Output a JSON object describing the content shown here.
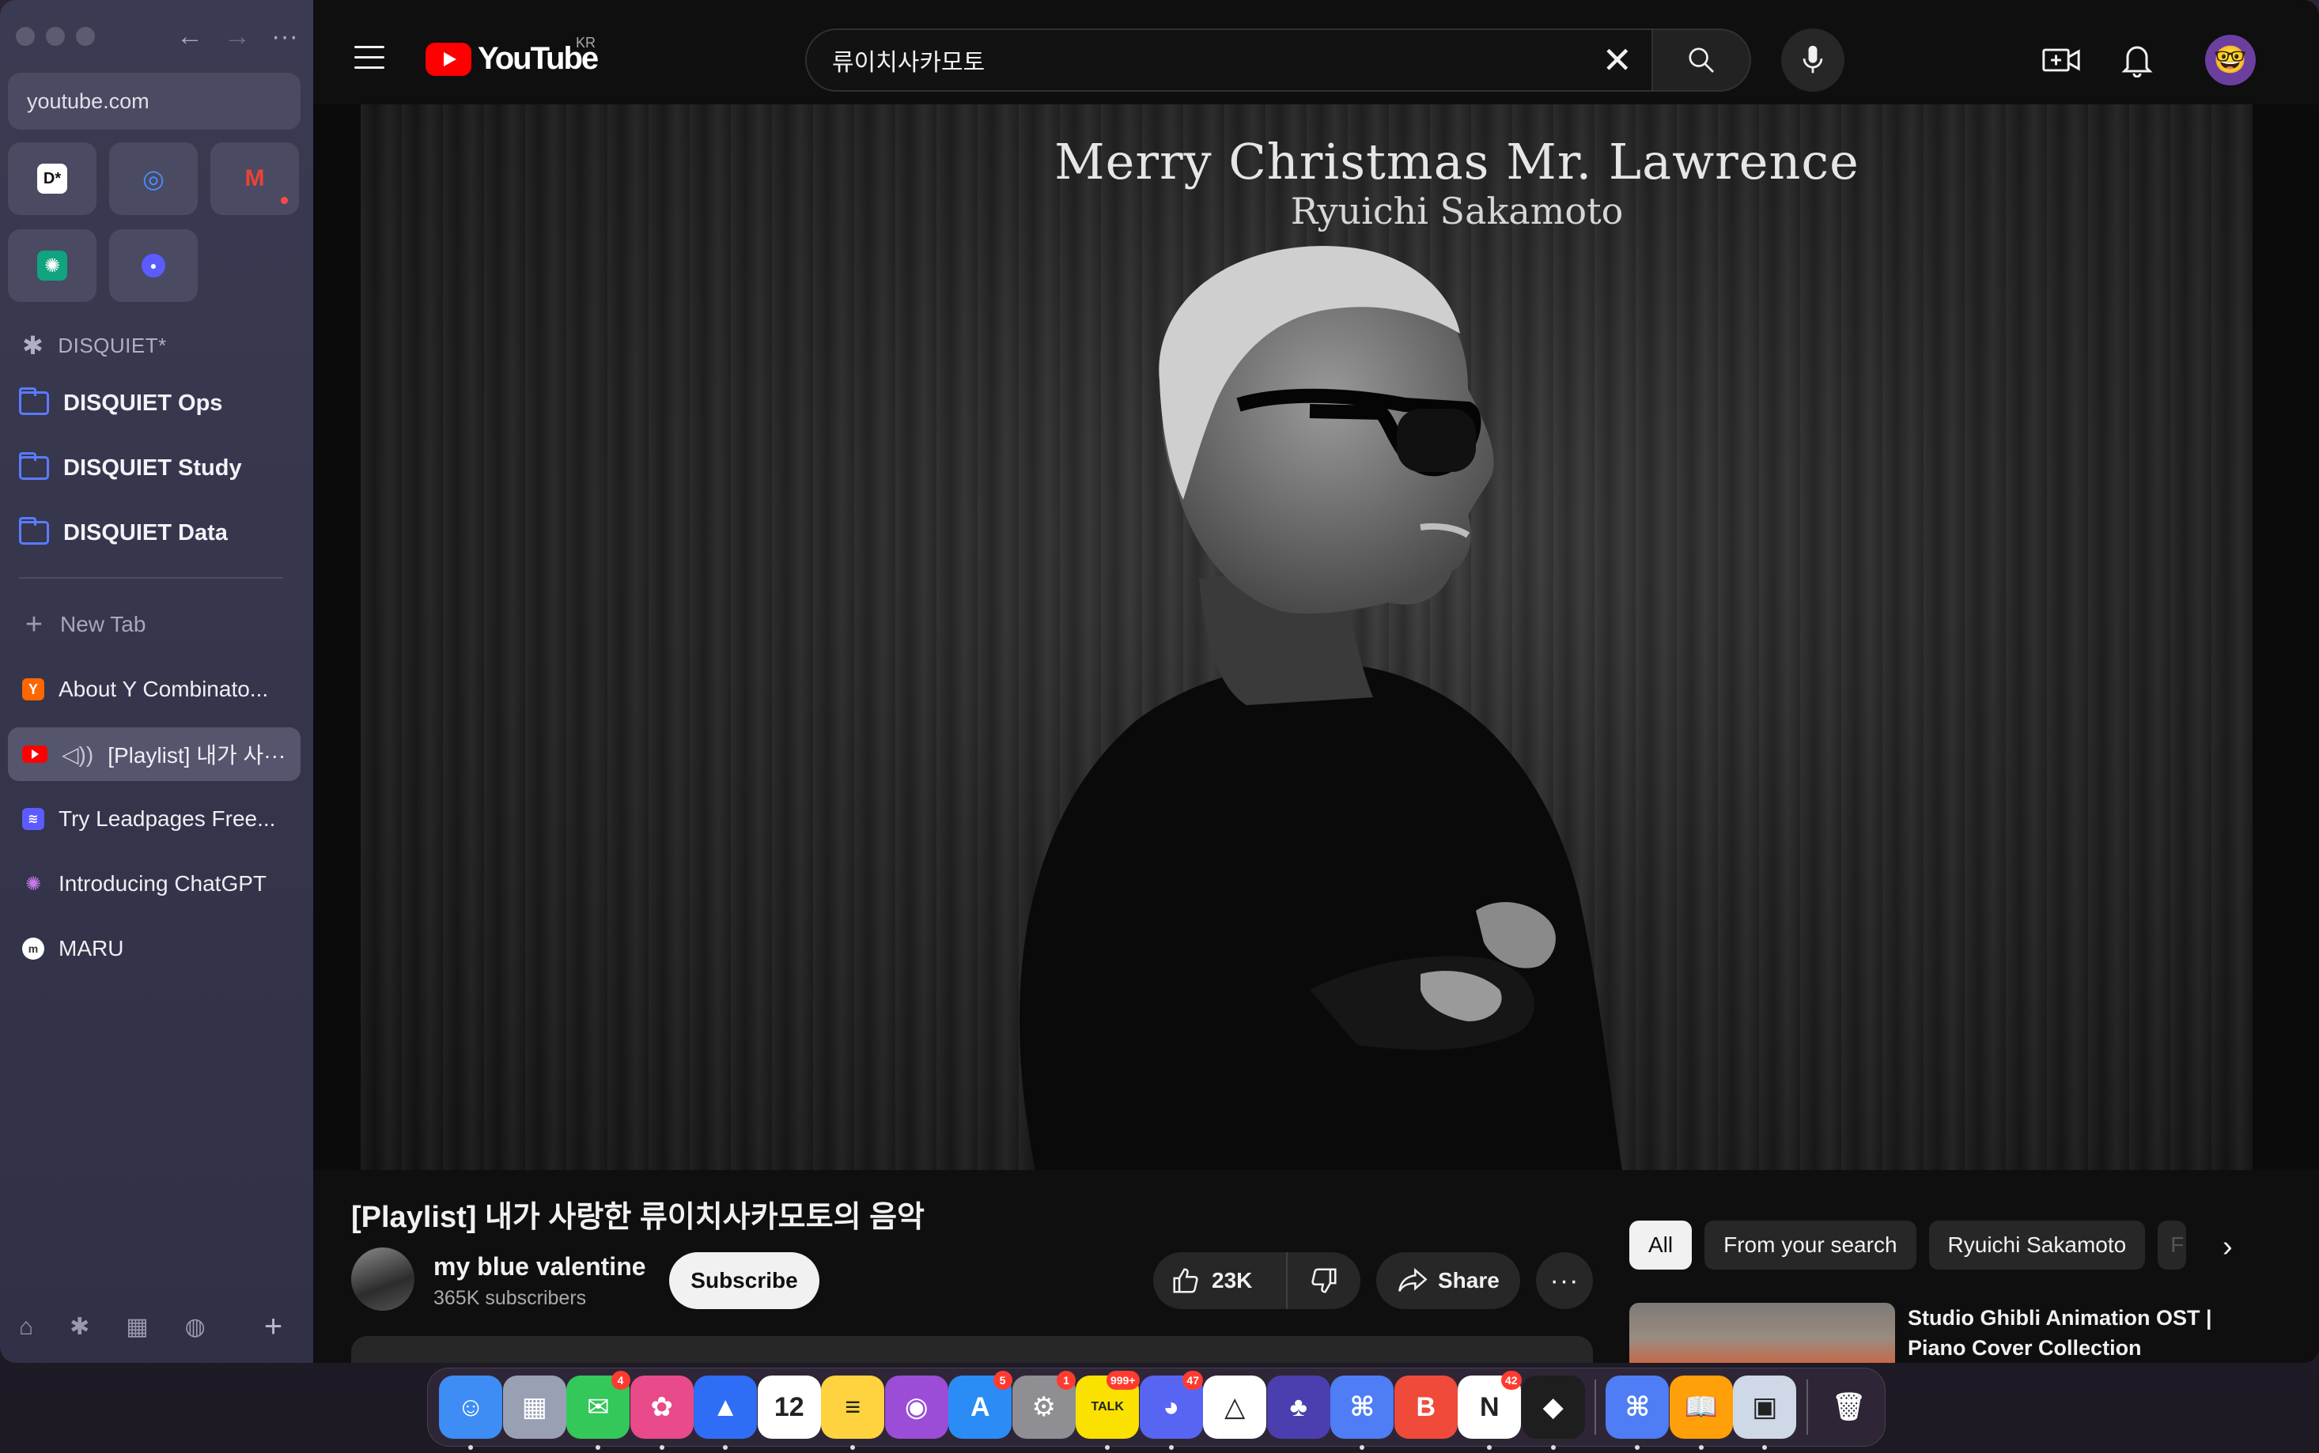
{
  "browser": {
    "url": "youtube.com",
    "space_label": "DISQUIET*",
    "folders": [
      {
        "label": "DISQUIET Ops"
      },
      {
        "label": "DISQUIET Study"
      },
      {
        "label": "DISQUIET Data"
      }
    ],
    "new_tab_label": "New Tab",
    "tabs": [
      {
        "label": "About Y Combinato...",
        "favicon": "Y",
        "color": "#ff6600"
      },
      {
        "label": "[Playlist] 내가 사···",
        "favicon": "youtube-icon",
        "color": "#ff0000",
        "active": true
      },
      {
        "label": "Try Leadpages Free...",
        "favicon": "leadpages-icon",
        "color": "#5b5bff"
      },
      {
        "label": "Introducing ChatGPT",
        "favicon": "openai-icon",
        "color": "#b06bd6"
      },
      {
        "label": "MARU",
        "favicon": "maru-icon",
        "color": "#ffffff"
      }
    ],
    "pinned": [
      {
        "name": "disquiet-app",
        "glyph": "D*"
      },
      {
        "name": "target-app",
        "glyph": "◎"
      },
      {
        "name": "gmail-app",
        "glyph": "M"
      },
      {
        "name": "chatgpt-app",
        "glyph": "✺"
      },
      {
        "name": "dot-app",
        "glyph": "●"
      }
    ]
  },
  "youtube": {
    "logo_text": "YouTube",
    "region": "KR",
    "search_query": "류이치사카모토",
    "video_overlay_title": "Merry Christmas Mr.  Lawrence",
    "video_overlay_subtitle": "Ryuichi Sakamoto",
    "video_title": "[Playlist] 내가 사랑한 류이치사카모토의 음악",
    "channel_name": "my blue valentine",
    "channel_subs": "365K subscribers",
    "subscribe_label": "Subscribe",
    "likes": "23K",
    "share_label": "Share",
    "chips": [
      "All",
      "From your search",
      "Ryuichi Sakamoto",
      "F"
    ],
    "recommended": {
      "title": "Studio Ghibli Animation OST | Piano Cover Collection"
    }
  },
  "dock": {
    "apps": [
      {
        "name": "finder",
        "glyph": "☺",
        "bg": "#3d8df5",
        "badge": "",
        "running": true
      },
      {
        "name": "launchpad",
        "glyph": "▦",
        "bg": "#9aa0b4",
        "badge": "",
        "running": false
      },
      {
        "name": "messages",
        "glyph": "✉",
        "bg": "#34c759",
        "badge": "4",
        "running": true
      },
      {
        "name": "photo-editor",
        "glyph": "✿",
        "bg": "#e84a8a",
        "badge": "",
        "running": true
      },
      {
        "name": "spark",
        "glyph": "▲",
        "bg": "#2f6df6",
        "badge": "",
        "running": true
      },
      {
        "name": "calendar",
        "glyph": "12",
        "bg": "#ffffff",
        "badge": "",
        "running": false
      },
      {
        "name": "notes",
        "glyph": "≡",
        "bg": "#ffd23f",
        "badge": "",
        "running": true
      },
      {
        "name": "podcasts",
        "glyph": "◉",
        "bg": "#9b4dd8",
        "badge": "",
        "running": false
      },
      {
        "name": "app-store",
        "glyph": "A",
        "bg": "#2b8cf5",
        "badge": "5",
        "running": false
      },
      {
        "name": "system-settings",
        "glyph": "⚙",
        "bg": "#8e8e93",
        "badge": "1",
        "running": false
      },
      {
        "name": "kakaotalk",
        "glyph": "TALK",
        "bg": "#fae100",
        "badge": "999+",
        "running": true
      },
      {
        "name": "discord",
        "glyph": "◕",
        "bg": "#5865f2",
        "badge": "47",
        "running": true
      },
      {
        "name": "arc-alt",
        "glyph": "△",
        "bg": "#ffffff",
        "badge": "",
        "running": false
      },
      {
        "name": "linear",
        "glyph": "♣",
        "bg": "#4b3fb0",
        "badge": "",
        "running": false
      },
      {
        "name": "arc",
        "glyph": "⌘",
        "bg": "#4f7df5",
        "badge": "",
        "running": true
      },
      {
        "name": "bear",
        "glyph": "B",
        "bg": "#f04a3a",
        "badge": "",
        "running": false
      },
      {
        "name": "notion",
        "glyph": "N",
        "bg": "#ffffff",
        "badge": "42",
        "running": true
      },
      {
        "name": "figma",
        "glyph": "◆",
        "bg": "#1e1e1e",
        "badge": "",
        "running": true
      }
    ],
    "recent": [
      {
        "name": "arc-recent",
        "glyph": "⌘",
        "bg": "#4f7df5",
        "running": true
      },
      {
        "name": "books",
        "glyph": "📖",
        "bg": "#ff9f0a",
        "running": true
      },
      {
        "name": "preview",
        "glyph": "▣",
        "bg": "#cfd8e6",
        "running": true
      }
    ],
    "trash": {
      "name": "trash",
      "glyph": "🗑",
      "bg": "transparent"
    }
  }
}
